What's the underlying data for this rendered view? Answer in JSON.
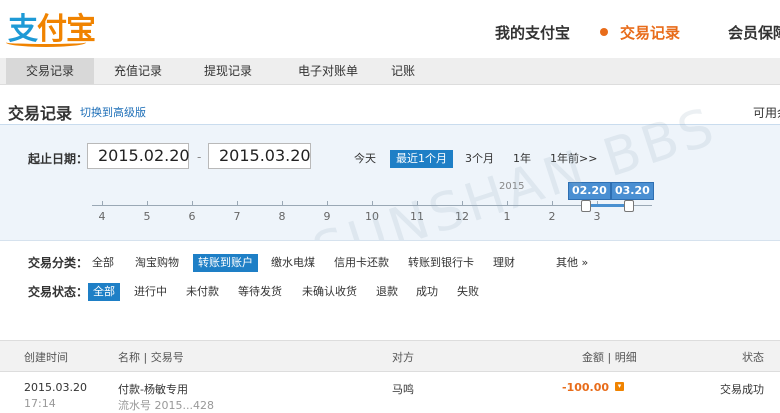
{
  "header": {
    "logo_text_a": "支",
    "logo_text_b": "付宝",
    "nav": [
      "我的支付宝",
      "交易记录",
      "会员保障"
    ]
  },
  "subnav": [
    "交易记录",
    "充值记录",
    "提现记录",
    "电子对账单",
    "记账"
  ],
  "page": {
    "title": "交易记录",
    "switch_link": "切换到高级版",
    "right_cut": "可用余"
  },
  "filter": {
    "date_label": "起止日期：",
    "start_date": "2015.02.20",
    "end_date": "2015.03.20",
    "dash": "-",
    "ranges": [
      "今天",
      "最近1个月",
      "3个月",
      "1年",
      "1年前>>"
    ],
    "active_range": "最近1个月",
    "timeline": {
      "year": "2015",
      "months": [
        "4",
        "5",
        "6",
        "7",
        "8",
        "9",
        "10",
        "11",
        "12",
        "1",
        "2",
        "3"
      ],
      "selected_start": "02.20",
      "selected_end": "03.20"
    }
  },
  "category": {
    "label": "交易分类：",
    "options": [
      "全部",
      "淘宝购物",
      "转账到账户",
      "缴水电煤",
      "信用卡还款",
      "转账到银行卡",
      "理财"
    ],
    "active": "转账到账户",
    "more": "其他 »"
  },
  "status": {
    "label": "交易状态：",
    "options": [
      "全部",
      "进行中",
      "未付款",
      "等待发货",
      "未确认收货",
      "退款",
      "成功",
      "失败"
    ],
    "active": "全部"
  },
  "table": {
    "headers": {
      "created": "创建时间",
      "name": "名称 | 交易号",
      "party": "对方",
      "amount": "金额 | 明细",
      "status": "状态"
    },
    "rows": [
      {
        "date": "2015.03.20",
        "time": "17:14",
        "name": "付款-杨敏专用",
        "serial": "流水号 2015...428",
        "party": "马鸣",
        "amount": "-100.00",
        "status": "交易成功"
      }
    ]
  },
  "colors": {
    "accent_blue": "#1e7fc6",
    "accent_orange": "#e86c1a",
    "filter_bg": "#eef4fa"
  }
}
